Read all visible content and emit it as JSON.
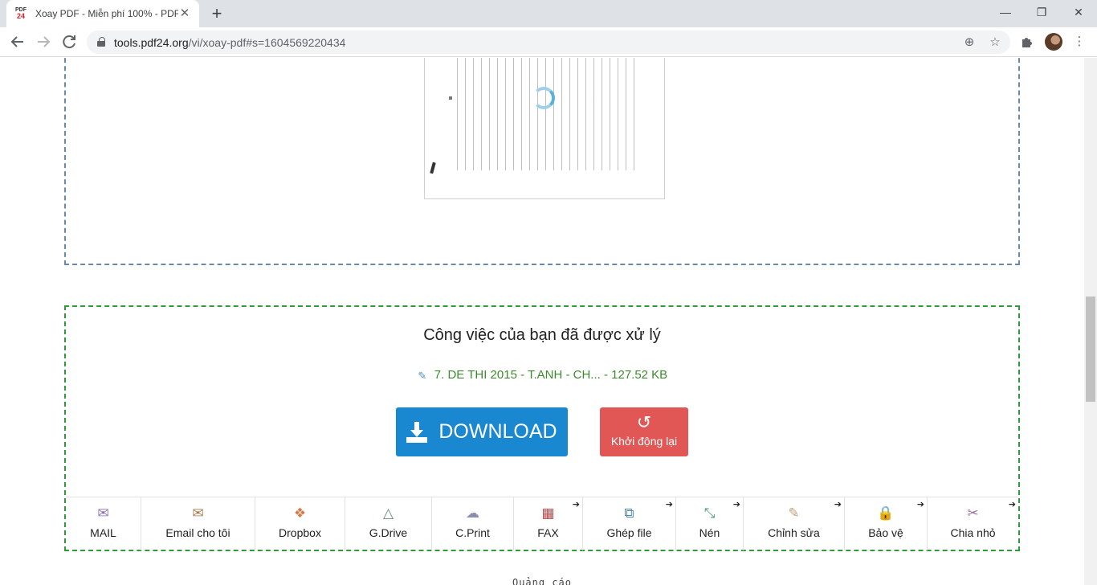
{
  "browser": {
    "tab_title": "Xoay PDF - Miễn phí 100% - PDF",
    "favicon_text_top": "PDF",
    "favicon_text_bottom": "24",
    "new_tab": "+",
    "url_host": "tools.pdf24.org",
    "url_path": "/vi/xoay-pdf#s=1604569220434",
    "controls": {
      "minimize": "—",
      "maximize": "❐",
      "close": "✕"
    }
  },
  "result": {
    "title": "Công việc của bạn đã được xử lý",
    "file_label": "7. DE THI 2015 - T.ANH - CH... - 127.52 KB",
    "download_label": "DOWNLOAD",
    "restart_label": "Khởi động lại"
  },
  "actions": [
    {
      "label": "MAIL",
      "icon": "envelope-icon",
      "color": "#8e6ea6",
      "arrow": false,
      "width": 94
    },
    {
      "label": "Email cho tôi",
      "icon": "envelope-icon",
      "color": "#a77a4c",
      "arrow": false,
      "width": 142
    },
    {
      "label": "Dropbox",
      "icon": "dropbox-icon",
      "color": "#d67b4c",
      "arrow": false,
      "width": 112
    },
    {
      "label": "G.Drive",
      "icon": "drive-icon",
      "color": "#6a8a7a",
      "arrow": false,
      "width": 108
    },
    {
      "label": "C.Print",
      "icon": "cloud-print-icon",
      "color": "#8a8fb0",
      "arrow": false,
      "width": 102
    },
    {
      "label": "FAX",
      "icon": "fax-icon",
      "color": "#b84a4a",
      "arrow": true,
      "width": 86
    },
    {
      "label": "Ghép file",
      "icon": "merge-icon",
      "color": "#4c8ab0",
      "arrow": true,
      "width": 116
    },
    {
      "label": "Nén",
      "icon": "compress-icon",
      "color": "#4c9a7a",
      "arrow": true,
      "width": 84
    },
    {
      "label": "Chỉnh sửa",
      "icon": "pencil-icon",
      "color": "#c4a07a",
      "arrow": true,
      "width": 126
    },
    {
      "label": "Bảo vệ",
      "icon": "lock-icon",
      "color": "#6a7fa8",
      "arrow": true,
      "width": 103
    },
    {
      "label": "Chia nhỏ",
      "icon": "scissors-icon",
      "color": "#9a6a9a",
      "arrow": true,
      "width": 113
    }
  ],
  "ad_label": "Quảng cáo",
  "colors": {
    "download": "#1a88d1",
    "restart": "#e15756",
    "success_border": "#2e9a3a",
    "file_text": "#3c8a2e"
  }
}
